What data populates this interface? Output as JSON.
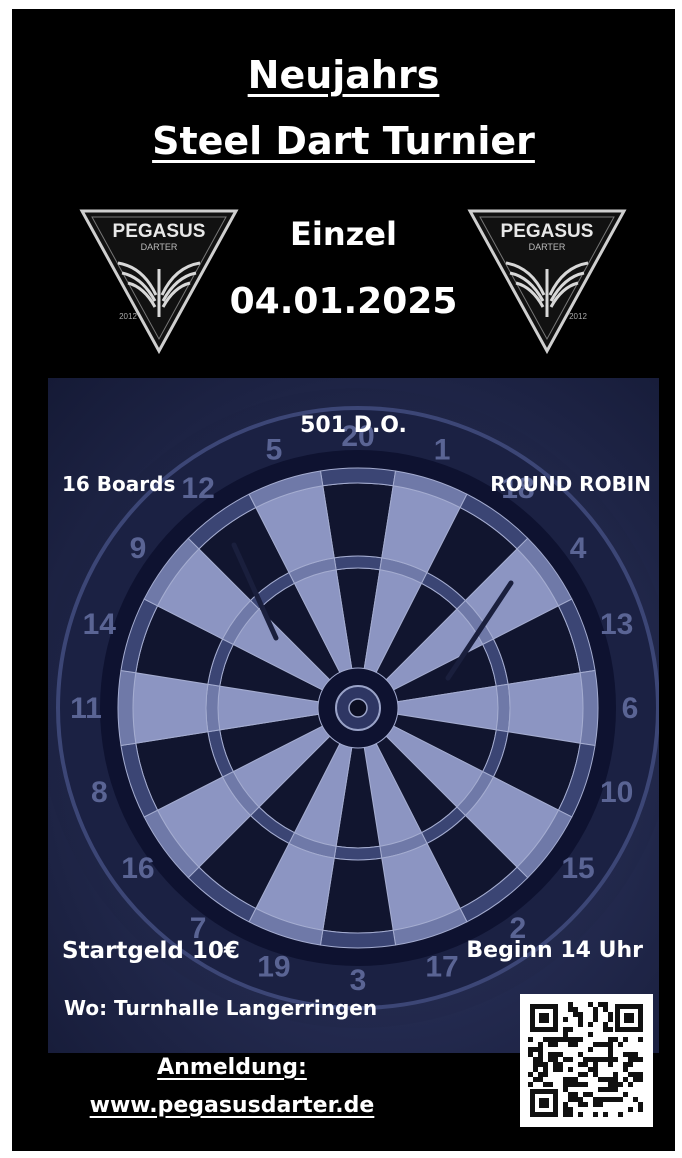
{
  "title": {
    "line1": "Neujahrs",
    "line2": "Steel Dart Turnier"
  },
  "logo": {
    "name": "PEGASUS",
    "sub": "DARTER",
    "year": "2012"
  },
  "event": {
    "type": "Einzel",
    "date": "04.01.2025"
  },
  "details": {
    "format": "501 D.O.",
    "boards": "16 Boards",
    "mode": "ROUND ROBIN",
    "fee": "Startgeld 10€",
    "start": "Beginn 14 Uhr",
    "venue": "Wo: Turnhalle Langerringen"
  },
  "signup": {
    "label": "Anmeldung:",
    "url": "www.pegasusdarter.de"
  },
  "board_numbers": [
    "20",
    "1",
    "18",
    "4",
    "13",
    "6",
    "10",
    "15",
    "2",
    "17",
    "3",
    "19",
    "7",
    "16",
    "8",
    "11",
    "14",
    "9",
    "12",
    "5"
  ],
  "colors": {
    "background": "#000000",
    "board_tint": "#252c52",
    "text": "#ffffff"
  }
}
